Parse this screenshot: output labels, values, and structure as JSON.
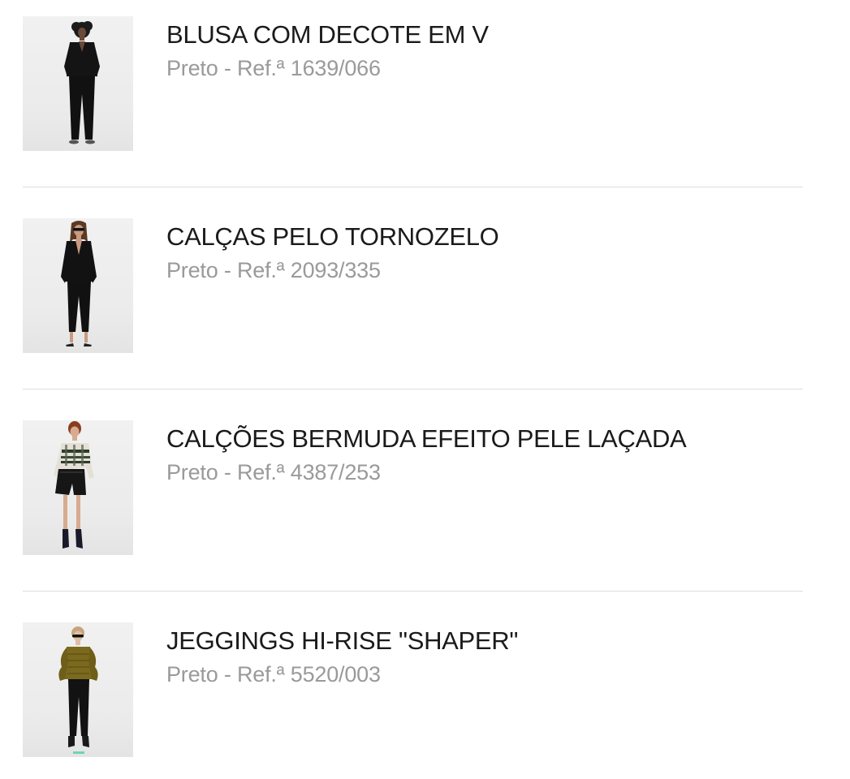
{
  "products": [
    {
      "name": "BLUSA COM DECOTE EM V",
      "color": "Preto",
      "separator": "-",
      "ref_label": "Ref.ª",
      "ref": "1639/066"
    },
    {
      "name": "CALÇAS PELO TORNOZELO",
      "color": "Preto",
      "separator": "-",
      "ref_label": "Ref.ª",
      "ref": "2093/335"
    },
    {
      "name": "CALÇÕES BERMUDA EFEITO PELE LAÇADA",
      "color": "Preto",
      "separator": "-",
      "ref_label": "Ref.ª",
      "ref": "4387/253"
    },
    {
      "name": "JEGGINGS HI-RISE \"SHAPER\"",
      "color": "Preto",
      "separator": "-",
      "ref_label": "Ref.ª",
      "ref": "5520/003"
    }
  ],
  "colors": {
    "title": "#1a1a1a",
    "meta": "#9a9a9a",
    "divider": "#dedede"
  }
}
